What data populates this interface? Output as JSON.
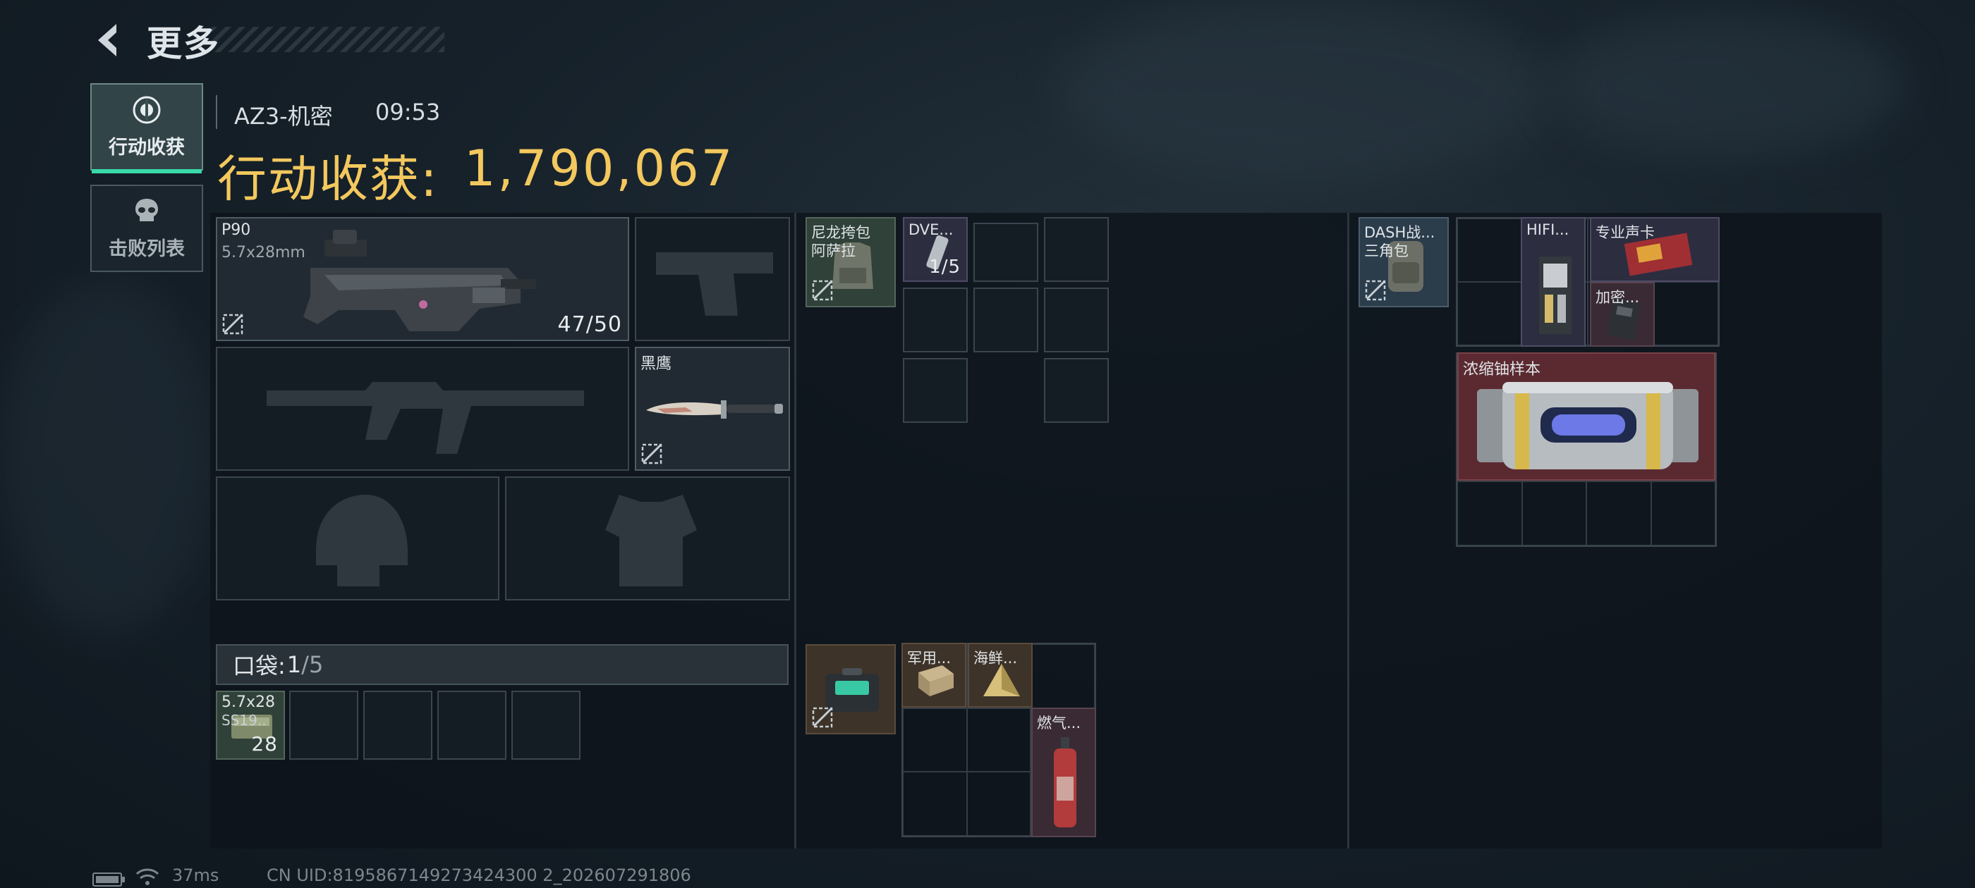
{
  "header": {
    "title": "更多"
  },
  "tabs": [
    {
      "label": "行动收获",
      "icon": "target-icon",
      "active": true
    },
    {
      "label": "击败列表",
      "icon": "skull-icon",
      "active": false
    }
  ],
  "match": {
    "map": "AZ3-机密",
    "time": "09:53"
  },
  "loot": {
    "label": "行动收获:",
    "value": "1,790,067"
  },
  "equipment": {
    "primary": {
      "name": "P90",
      "caliber": "5.7x28mm",
      "ammo": "47/50"
    },
    "melee": {
      "name": "黑鹰"
    }
  },
  "pocket": {
    "label": "口袋:",
    "current": "1",
    "max": "/5"
  },
  "pocket_items": [
    {
      "name_line1": "5.7x28",
      "name_line2": "SS19..",
      "count": "28"
    }
  ],
  "rig": {
    "name_line1": "尼龙挎包",
    "name_line2": "阿萨拉",
    "items": [
      {
        "name": "DVE...",
        "count": "1/5"
      }
    ]
  },
  "case": {
    "items": [
      {
        "name": "军用..."
      },
      {
        "name": "海鲜..."
      },
      {
        "name": "燃气..."
      }
    ]
  },
  "backpack": {
    "name_line1": "DASH战...",
    "name_line2": "三角包",
    "items": [
      {
        "name": "HIFI..."
      },
      {
        "name": "专业声卡"
      },
      {
        "name": "加密..."
      },
      {
        "name": "浓缩铀样本"
      }
    ]
  },
  "status": {
    "ping": "37ms",
    "uid": "CN UID:8195867149273424300 2_202607291806"
  },
  "colors": {
    "accent": "#38d9a9",
    "gold": "#f3c85e"
  }
}
